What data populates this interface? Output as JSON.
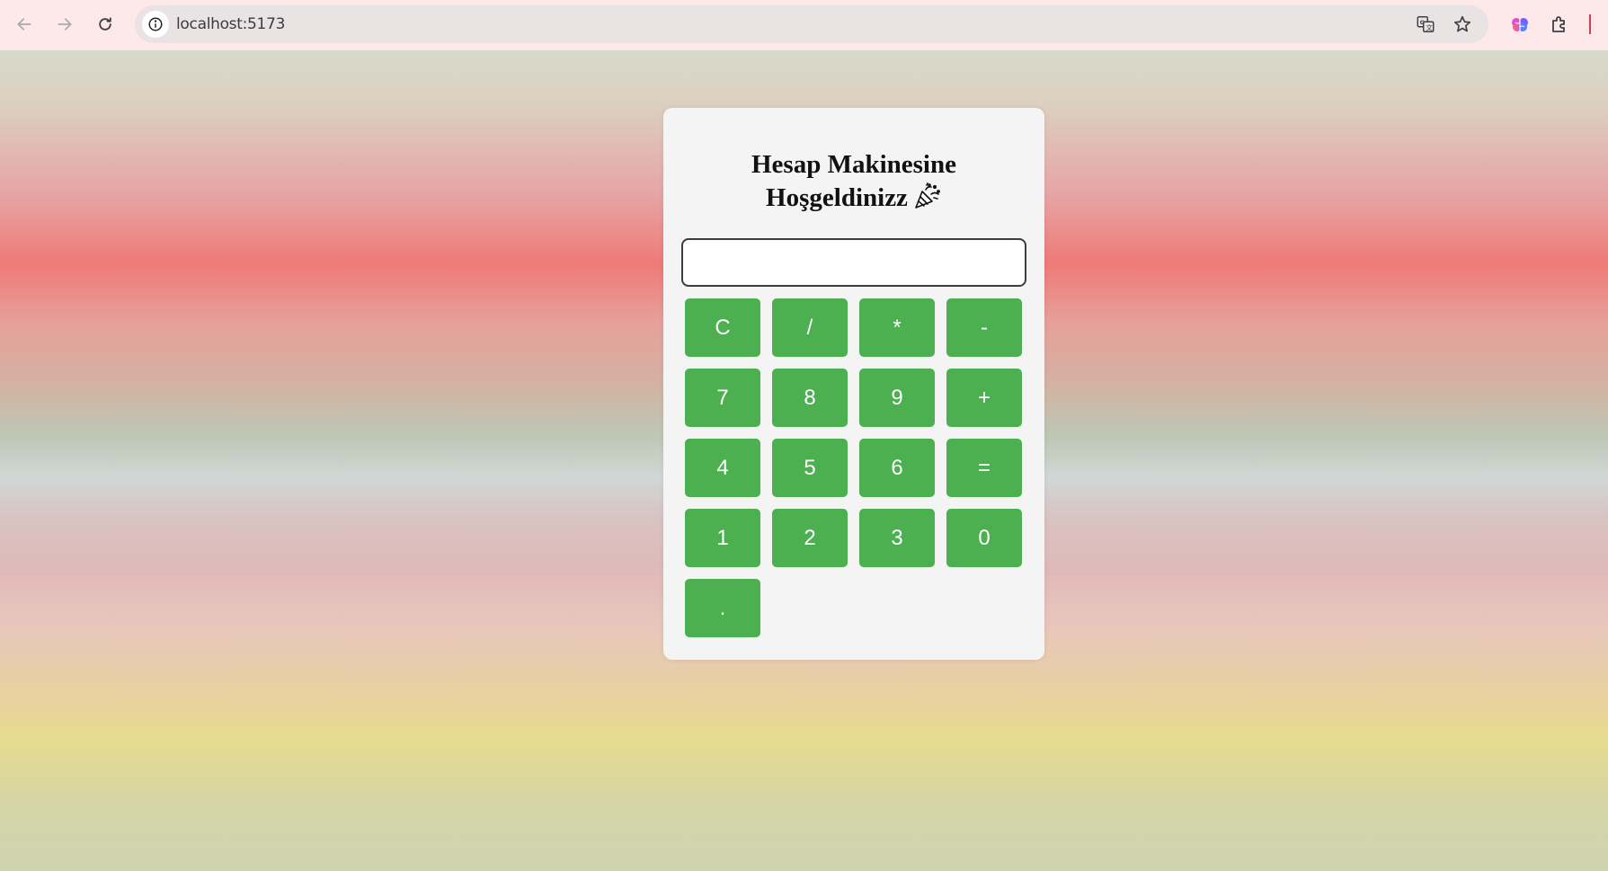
{
  "browser": {
    "url": "localhost:5173",
    "back_icon": "arrow-left-icon",
    "forward_icon": "arrow-right-icon",
    "reload_icon": "reload-icon",
    "site_info_icon": "info-icon",
    "translate_icon": "translate-icon",
    "bookmark_icon": "star-icon",
    "extension_icons": [
      "brain-extension-icon",
      "puzzle-icon"
    ]
  },
  "app": {
    "title_line1": "Hesap Makinesine",
    "title_line2": "Hoşgeldinizz",
    "title_emoji_icon": "party-popper-icon",
    "display_value": "",
    "keys": [
      [
        "C",
        "/",
        "*",
        "-"
      ],
      [
        "7",
        "8",
        "9",
        "+"
      ],
      [
        "4",
        "5",
        "6",
        "="
      ],
      [
        "1",
        "2",
        "3",
        "0"
      ],
      [
        "."
      ]
    ]
  },
  "colors": {
    "button_green": "#4caf50",
    "button_text": "#ffffff",
    "card_bg": "#f4f4f4",
    "browser_bar": "#fde8ea"
  }
}
